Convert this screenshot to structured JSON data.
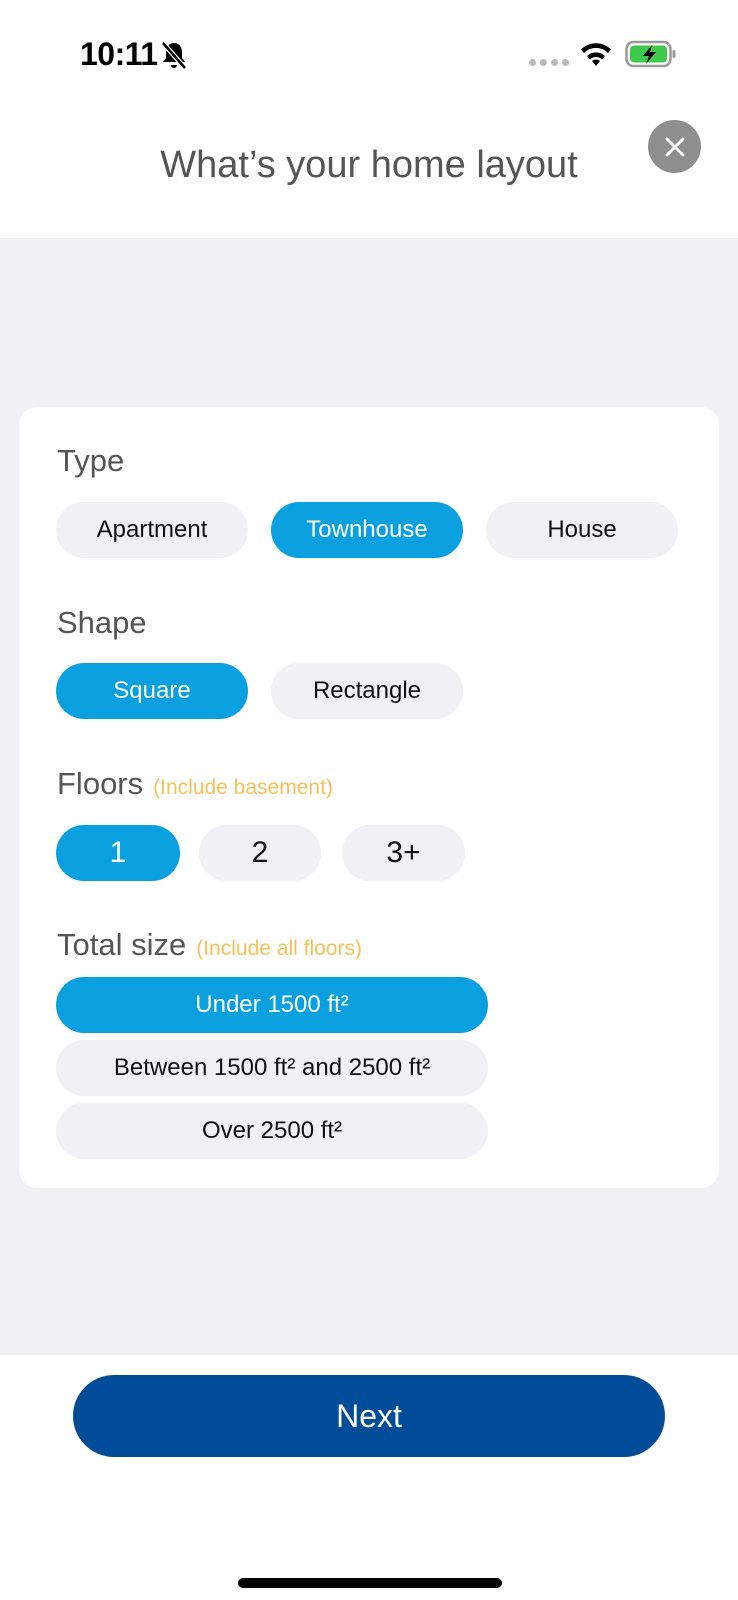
{
  "status_bar": {
    "time": "10:11",
    "icons": [
      "bell-slash-icon",
      "cellular-signal-icon",
      "wifi-icon",
      "battery-charging-icon"
    ],
    "battery_color": "#3fc94d"
  },
  "header": {
    "title": "What’s your home layout",
    "close_icon": "close-icon"
  },
  "form": {
    "type": {
      "label": "Type",
      "options": [
        "Apartment",
        "Townhouse",
        "House"
      ],
      "selected": "Townhouse"
    },
    "shape": {
      "label": "Shape",
      "options": [
        "Square",
        "Rectangle"
      ],
      "selected": "Square"
    },
    "floors": {
      "label": "Floors",
      "hint": "(Include basement)",
      "options": [
        "1",
        "2",
        "3+"
      ],
      "selected": "1"
    },
    "total_size": {
      "label": "Total size",
      "hint": "(Include all floors)",
      "options": [
        "Under 1500 ft²",
        "Between 1500 ft² and 2500 ft²",
        "Over 2500 ft²"
      ],
      "selected": "Under 1500 ft²"
    }
  },
  "footer": {
    "next_label": "Next"
  },
  "colors": {
    "selected": "#0a9fde",
    "unselected": "#eff1f5",
    "primary_button": "#004c98",
    "hint": "#f6c157"
  }
}
